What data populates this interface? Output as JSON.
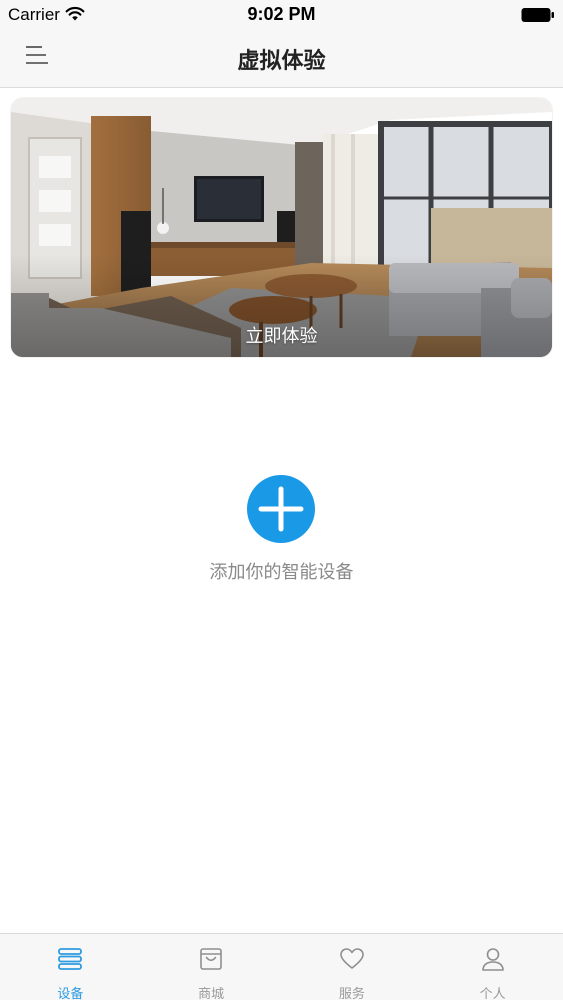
{
  "status_bar": {
    "carrier": "Carrier",
    "time": "9:02 PM",
    "wifi_icon": "wifi-icon",
    "battery_icon": "battery-icon"
  },
  "nav_bar": {
    "title": "虚拟体验",
    "menu_icon": "menu-icon"
  },
  "banner": {
    "image": "living-room-photo",
    "label": "立即体验"
  },
  "add_device": {
    "icon": "plus-icon",
    "label": "添加你的智能设备",
    "color": "#1a9ae6"
  },
  "tab_bar": {
    "active_color": "#2f9be0",
    "inactive_color": "#9a9a9a",
    "tabs": [
      {
        "label": "设备",
        "icon": "devices-list-icon",
        "active": true
      },
      {
        "label": "商城",
        "icon": "shop-bag-icon",
        "active": false
      },
      {
        "label": "服务",
        "icon": "heart-icon",
        "active": false
      },
      {
        "label": "个人",
        "icon": "person-icon",
        "active": false
      }
    ]
  }
}
